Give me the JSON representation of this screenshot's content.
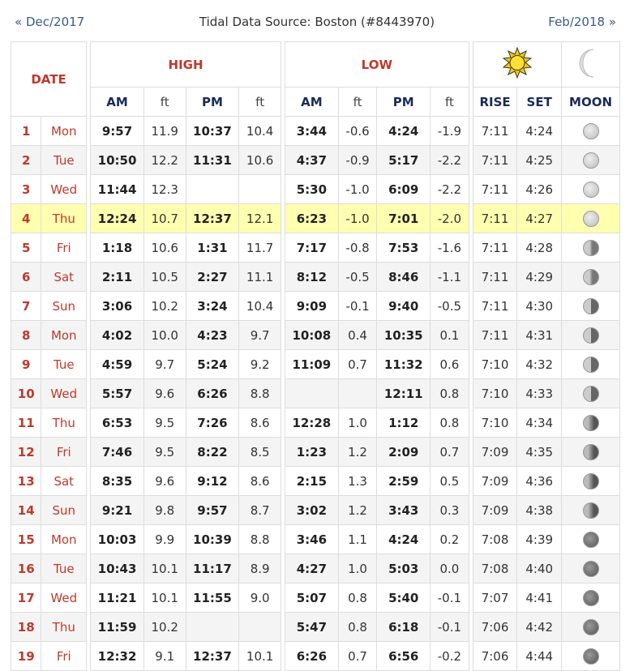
{
  "nav": {
    "prev": "« Dec/2017",
    "title": "Tidal Data Source: Boston (#8443970)",
    "next": "Feb/2018 »"
  },
  "headers": {
    "date": "DATE",
    "high": "HIGH",
    "low": "LOW",
    "am": "AM",
    "ft": "ft",
    "pm": "PM",
    "rise": "RISE",
    "set": "SET",
    "moon": "MOON"
  },
  "rows": [
    {
      "d": "1",
      "dow": "Mon",
      "ham": "9:57",
      "hamf": "11.9",
      "hpm": "10:37",
      "hpmf": "10.4",
      "lam": "3:44",
      "lamf": "-0.6",
      "lpm": "4:24",
      "lpmf": "-1.9",
      "rise": "7:11",
      "set": "4:24",
      "moon": "p0"
    },
    {
      "d": "2",
      "dow": "Tue",
      "ham": "10:50",
      "hamf": "12.2",
      "hpm": "11:31",
      "hpmf": "10.6",
      "lam": "4:37",
      "lamf": "-0.9",
      "lpm": "5:17",
      "lpmf": "-2.2",
      "rise": "7:11",
      "set": "4:25",
      "moon": "p0"
    },
    {
      "d": "3",
      "dow": "Wed",
      "ham": "11:44",
      "hamf": "12.3",
      "hpm": "",
      "hpmf": "",
      "lam": "5:30",
      "lamf": "-1.0",
      "lpm": "6:09",
      "lpmf": "-2.2",
      "rise": "7:11",
      "set": "4:26",
      "moon": "p0"
    },
    {
      "d": "4",
      "dow": "Thu",
      "ham": "12:24",
      "hamf": "10.7",
      "hpm": "12:37",
      "hpmf": "12.1",
      "lam": "6:23",
      "lamf": "-1.0",
      "lpm": "7:01",
      "lpmf": "-2.0",
      "rise": "7:11",
      "set": "4:27",
      "moon": "p0"
    },
    {
      "d": "5",
      "dow": "Fri",
      "ham": "1:18",
      "hamf": "10.6",
      "hpm": "1:31",
      "hpmf": "11.7",
      "lam": "7:17",
      "lamf": "-0.8",
      "lpm": "7:53",
      "lpmf": "-1.6",
      "rise": "7:11",
      "set": "4:28",
      "moon": "p1"
    },
    {
      "d": "6",
      "dow": "Sat",
      "ham": "2:11",
      "hamf": "10.5",
      "hpm": "2:27",
      "hpmf": "11.1",
      "lam": "8:12",
      "lamf": "-0.5",
      "lpm": "8:46",
      "lpmf": "-1.1",
      "rise": "7:11",
      "set": "4:29",
      "moon": "p1"
    },
    {
      "d": "7",
      "dow": "Sun",
      "ham": "3:06",
      "hamf": "10.2",
      "hpm": "3:24",
      "hpmf": "10.4",
      "lam": "9:09",
      "lamf": "-0.1",
      "lpm": "9:40",
      "lpmf": "-0.5",
      "rise": "7:11",
      "set": "4:30",
      "moon": "p2"
    },
    {
      "d": "8",
      "dow": "Mon",
      "ham": "4:02",
      "hamf": "10.0",
      "hpm": "4:23",
      "hpmf": "9.7",
      "lam": "10:08",
      "lamf": "0.4",
      "lpm": "10:35",
      "lpmf": "0.1",
      "rise": "7:11",
      "set": "4:31",
      "moon": "p2"
    },
    {
      "d": "9",
      "dow": "Tue",
      "ham": "4:59",
      "hamf": "9.7",
      "hpm": "5:24",
      "hpmf": "9.2",
      "lam": "11:09",
      "lamf": "0.7",
      "lpm": "11:32",
      "lpmf": "0.6",
      "rise": "7:10",
      "set": "4:32",
      "moon": "p2"
    },
    {
      "d": "10",
      "dow": "Wed",
      "ham": "5:57",
      "hamf": "9.6",
      "hpm": "6:26",
      "hpmf": "8.8",
      "lam": "",
      "lamf": "",
      "lpm": "12:11",
      "lpmf": "0.8",
      "rise": "7:10",
      "set": "4:33",
      "moon": "p2"
    },
    {
      "d": "11",
      "dow": "Thu",
      "ham": "6:53",
      "hamf": "9.5",
      "hpm": "7:26",
      "hpmf": "8.6",
      "lam": "12:28",
      "lamf": "1.0",
      "lpm": "1:12",
      "lpmf": "0.8",
      "rise": "7:10",
      "set": "4:34",
      "moon": "p3"
    },
    {
      "d": "12",
      "dow": "Fri",
      "ham": "7:46",
      "hamf": "9.5",
      "hpm": "8:22",
      "hpmf": "8.5",
      "lam": "1:23",
      "lamf": "1.2",
      "lpm": "2:09",
      "lpmf": "0.7",
      "rise": "7:09",
      "set": "4:35",
      "moon": "p3"
    },
    {
      "d": "13",
      "dow": "Sat",
      "ham": "8:35",
      "hamf": "9.6",
      "hpm": "9:12",
      "hpmf": "8.6",
      "lam": "2:15",
      "lamf": "1.3",
      "lpm": "2:59",
      "lpmf": "0.5",
      "rise": "7:09",
      "set": "4:36",
      "moon": "p3"
    },
    {
      "d": "14",
      "dow": "Sun",
      "ham": "9:21",
      "hamf": "9.8",
      "hpm": "9:57",
      "hpmf": "8.7",
      "lam": "3:02",
      "lamf": "1.2",
      "lpm": "3:43",
      "lpmf": "0.3",
      "rise": "7:09",
      "set": "4:38",
      "moon": "p3"
    },
    {
      "d": "15",
      "dow": "Mon",
      "ham": "10:03",
      "hamf": "9.9",
      "hpm": "10:39",
      "hpmf": "8.8",
      "lam": "3:46",
      "lamf": "1.1",
      "lpm": "4:24",
      "lpmf": "0.2",
      "rise": "7:08",
      "set": "4:39",
      "moon": "p4"
    },
    {
      "d": "16",
      "dow": "Tue",
      "ham": "10:43",
      "hamf": "10.1",
      "hpm": "11:17",
      "hpmf": "8.9",
      "lam": "4:27",
      "lamf": "1.0",
      "lpm": "5:03",
      "lpmf": "0.0",
      "rise": "7:08",
      "set": "4:40",
      "moon": "p4"
    },
    {
      "d": "17",
      "dow": "Wed",
      "ham": "11:21",
      "hamf": "10.1",
      "hpm": "11:55",
      "hpmf": "9.0",
      "lam": "5:07",
      "lamf": "0.8",
      "lpm": "5:40",
      "lpmf": "-0.1",
      "rise": "7:07",
      "set": "4:41",
      "moon": "p4"
    },
    {
      "d": "18",
      "dow": "Thu",
      "ham": "11:59",
      "hamf": "10.2",
      "hpm": "",
      "hpmf": "",
      "lam": "5:47",
      "lamf": "0.8",
      "lpm": "6:18",
      "lpmf": "-0.1",
      "rise": "7:06",
      "set": "4:42",
      "moon": "p4"
    },
    {
      "d": "19",
      "dow": "Fri",
      "ham": "12:32",
      "hamf": "9.1",
      "hpm": "12:37",
      "hpmf": "10.1",
      "lam": "6:26",
      "lamf": "0.7",
      "lpm": "6:56",
      "lpmf": "-0.2",
      "rise": "7:06",
      "set": "4:44",
      "moon": "p4"
    }
  ],
  "today_index": 3,
  "colors": {
    "accent_red": "#c0392b",
    "today_bg": "#ffffb0",
    "link": "#3a5a8a"
  }
}
